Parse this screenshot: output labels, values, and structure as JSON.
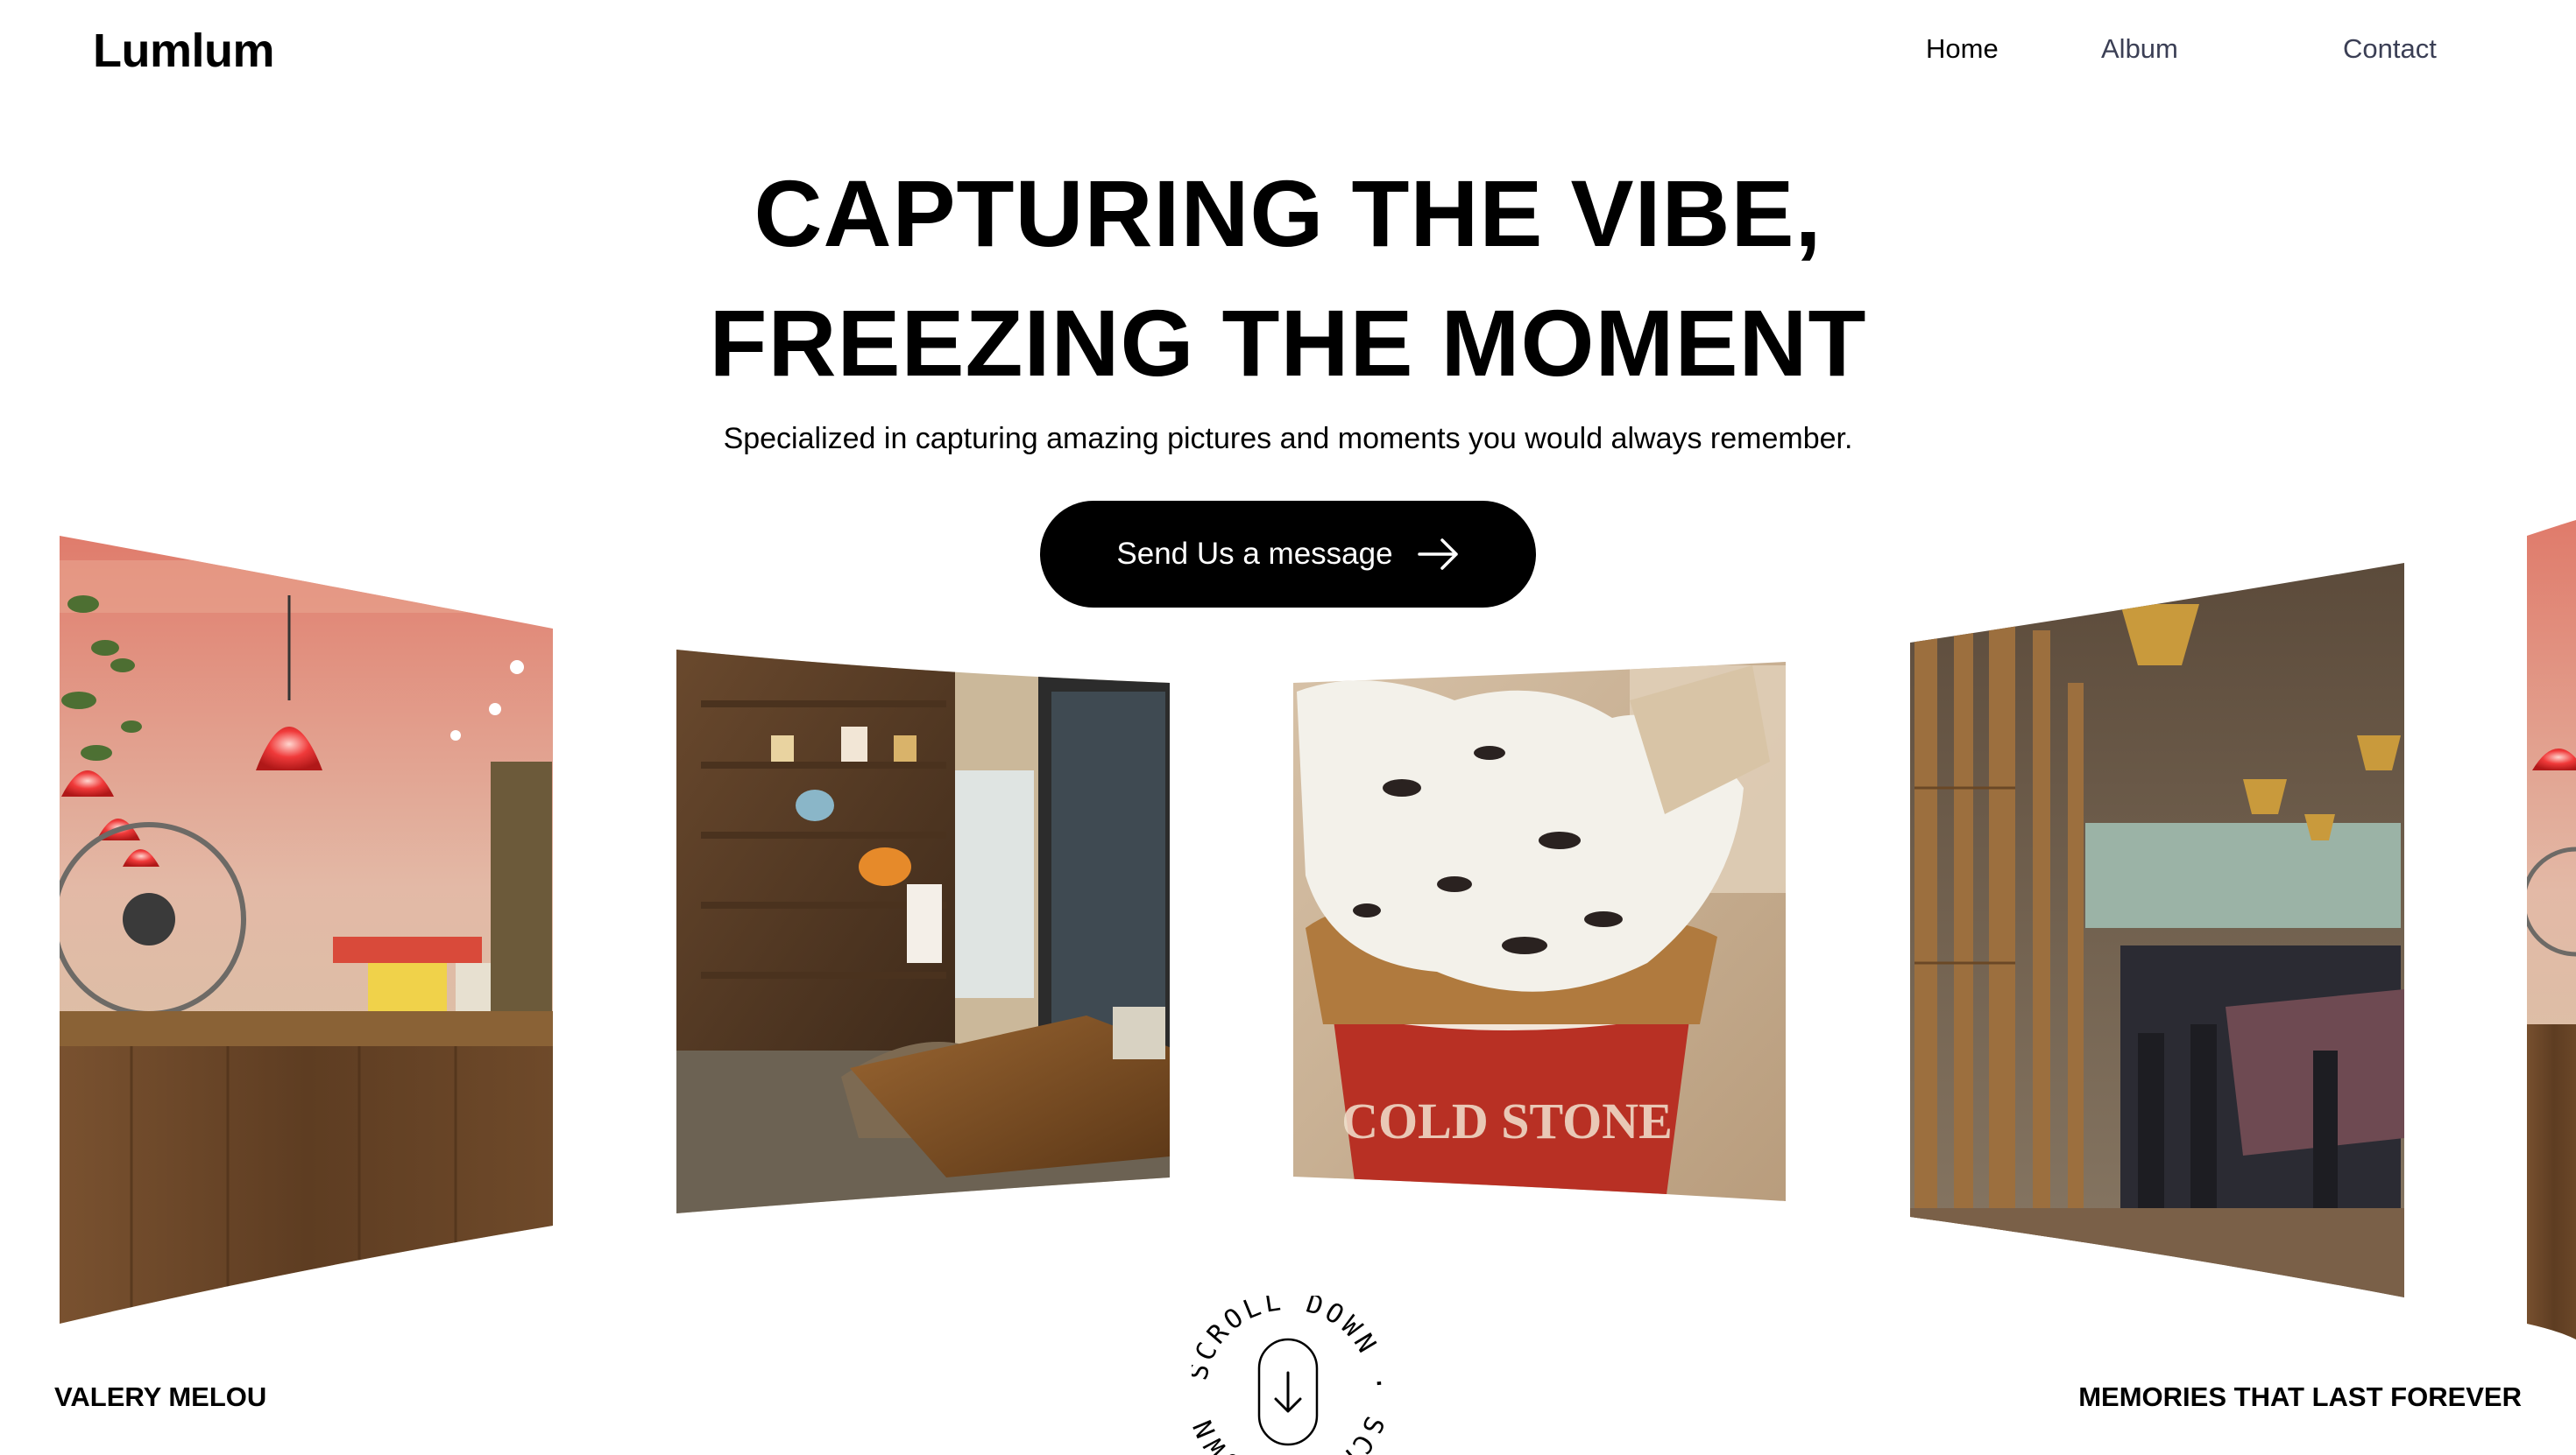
{
  "header": {
    "logo": "Lumlum",
    "nav": [
      {
        "label": "Home"
      },
      {
        "label": "Album"
      },
      {
        "label": "Contact"
      }
    ]
  },
  "hero": {
    "headline_line1": "CAPTURING THE VIBE,",
    "headline_line2": "FREEZING THE MOMENT",
    "subtitle": "Specialized in capturing amazing pictures and moments you would always remember.",
    "cta_label": "Send Us a message",
    "cta_icon": "arrow-right-icon"
  },
  "gallery": {
    "photos": [
      {
        "subject": "cafe-counter-with-red-lamps"
      },
      {
        "subject": "bakery-shelves-and-table"
      },
      {
        "subject": "ice-cream-cup"
      },
      {
        "subject": "bamboo-restaurant-interior"
      },
      {
        "subject": "cafe-counter-partial"
      }
    ]
  },
  "footer": {
    "left_text": "VALERY MELOU",
    "right_text": "MEMORIES THAT LAST FOREVER",
    "scroll_text": "SCROLL DOWN · SCROLL DOWN · ",
    "scroll_icon": "arrow-down-icon"
  },
  "colors": {
    "background": "#ffffff",
    "text": "#000000",
    "nav_inactive": "#3b3f55",
    "button_bg": "#000000",
    "button_text": "#ffffff"
  }
}
